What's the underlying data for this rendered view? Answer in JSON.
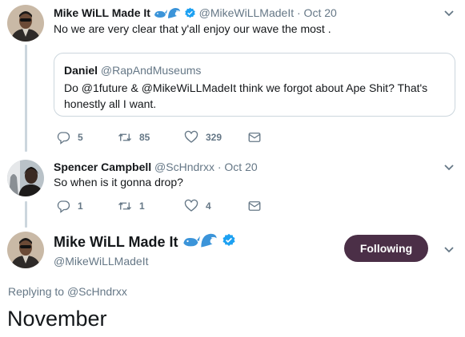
{
  "colors": {
    "text": "#14171a",
    "muted": "#657786",
    "verified": "#1da1f2",
    "wave": "#3b94d9",
    "follow_bg": "#4b2f47",
    "line": "#ccd6dd"
  },
  "tweet1": {
    "name": "Mike WiLL Made It",
    "emojis": [
      "whale-emoji",
      "wave-emoji"
    ],
    "handle": "@MikeWiLLMadeIt",
    "time": "· Oct 20",
    "text": "No we are very clear that y'all enjoy our wave the most .",
    "quote": {
      "name": "Daniel",
      "handle": "@RapAndMuseums",
      "text": "Do @1future & @MikeWiLLMadeIt think we forgot about Ape Shit? That's honestly all I want."
    },
    "actions": {
      "replies": "5",
      "retweets": "85",
      "likes": "329"
    }
  },
  "tweet2": {
    "name": "Spencer Campbell",
    "handle": "@ScHndrxx",
    "time": "· Oct 20",
    "text": "So when is it gonna drop?",
    "actions": {
      "replies": "1",
      "retweets": "1",
      "likes": "4"
    }
  },
  "main_tweet": {
    "name": "Mike WiLL Made It",
    "handle": "@MikeWiLLMadeIt",
    "follow_label": "Following",
    "replying_prefix": "Replying to",
    "replying_handle": "@ScHndrxx",
    "text": "November"
  }
}
